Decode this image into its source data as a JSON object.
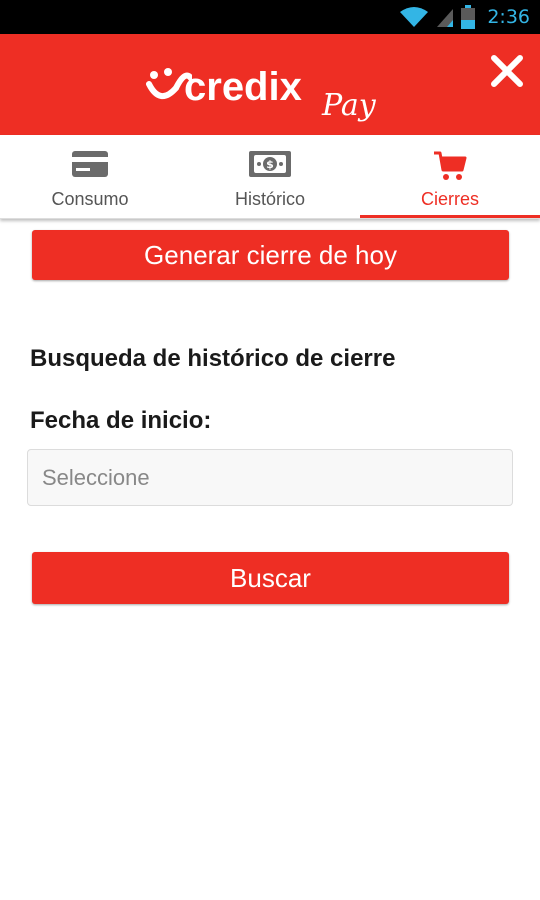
{
  "status_bar": {
    "time": "2:36",
    "icons": [
      "wifi-icon",
      "signal-icon",
      "battery-icon"
    ]
  },
  "header": {
    "brand": "credix",
    "brand_suffix": "Pay",
    "close_icon": "close-icon",
    "background": "#ee2e24"
  },
  "tabs": [
    {
      "label": "Consumo",
      "icon": "credit-card-icon",
      "active": false
    },
    {
      "label": "Histórico",
      "icon": "cash-icon",
      "active": false
    },
    {
      "label": "Cierres",
      "icon": "shopping-cart-icon",
      "active": true
    }
  ],
  "main": {
    "generate_button": "Generar cierre de hoy",
    "section_title": "Busqueda de histórico de cierre",
    "start_date_label": "Fecha de inicio:",
    "start_date_placeholder": "Seleccione",
    "start_date_value": "",
    "search_button": "Buscar"
  },
  "colors": {
    "accent": "#ee2e24",
    "status_blue": "#33b5e5",
    "tab_inactive": "#555555"
  }
}
